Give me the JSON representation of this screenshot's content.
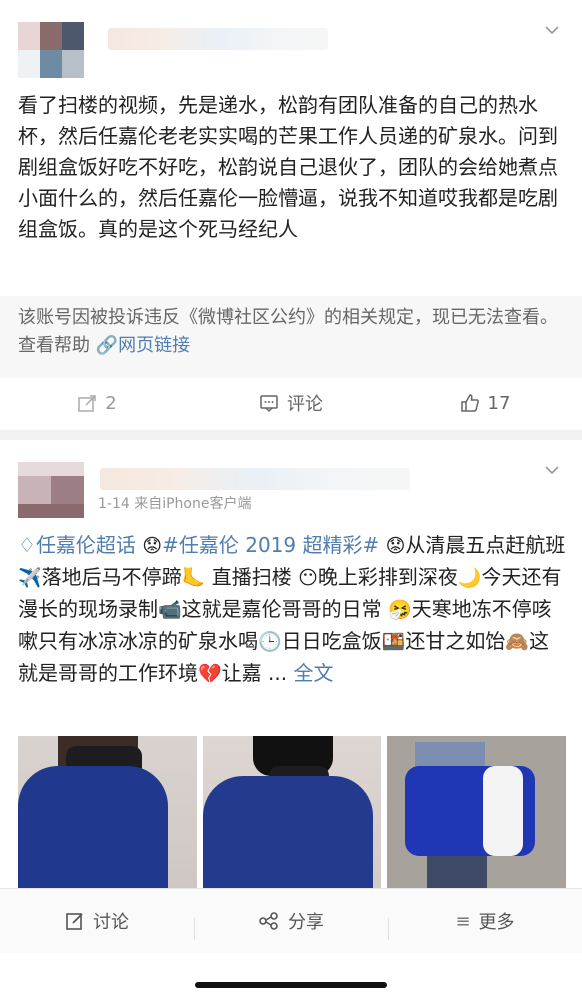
{
  "post1": {
    "body": "看了扫楼的视频，先是递水，松韵有团队准备的自己的热水杯，然后任嘉伦老老实实喝的芒果工作人员递的矿泉水。问到剧组盒饭好吃不好吃，松韵说自己退伙了，团队的会给她煮点小面什么的，然后任嘉伦一脸懵逼，说我不知道哎我都是吃剧组盒饭。真的是这个死马经纪人",
    "quote_text": "该账号因被投诉违反《微博社区公约》的相关规定，现已无法查看。查看帮助",
    "quote_link": "网页链接",
    "repost_count": "2",
    "comment_label": "评论",
    "like_count": "17"
  },
  "post2": {
    "meta": "1-14  来自iPhone客户端",
    "topic1": "任嘉伦超话",
    "topic2": "#任嘉伦 2019 超精彩#",
    "seg1": "从清晨五点赶航班",
    "seg2": "落地后马不停蹄",
    "seg3": " 直播扫楼",
    "seg4": "晚上彩排到深夜",
    "seg5": "今天还有漫长的现场录制",
    "seg6": "这就是嘉伦哥哥的日常",
    "seg7": "天寒地冻不停咳嗽只有冰凉冰凉的矿泉水喝",
    "seg8": "日日吃盒饭",
    "seg9": "还甘之如饴",
    "seg10": "这就是哥哥的工作环境",
    "seg11": "让嘉 ...",
    "more": "全文"
  },
  "bottom": {
    "discuss": "讨论",
    "share": "分享",
    "more": "更多"
  },
  "colors": {
    "link": "#507daf",
    "meta": "#999999"
  },
  "icons": [
    "chevron-down-icon",
    "repost-icon",
    "comment-icon",
    "like-icon",
    "diamond-icon",
    "plane-icon",
    "foot-icon",
    "moon-icon",
    "camera-icon",
    "lunchbox-icon",
    "broken-heart-icon",
    "edit-icon",
    "share-icon",
    "more-icon"
  ]
}
